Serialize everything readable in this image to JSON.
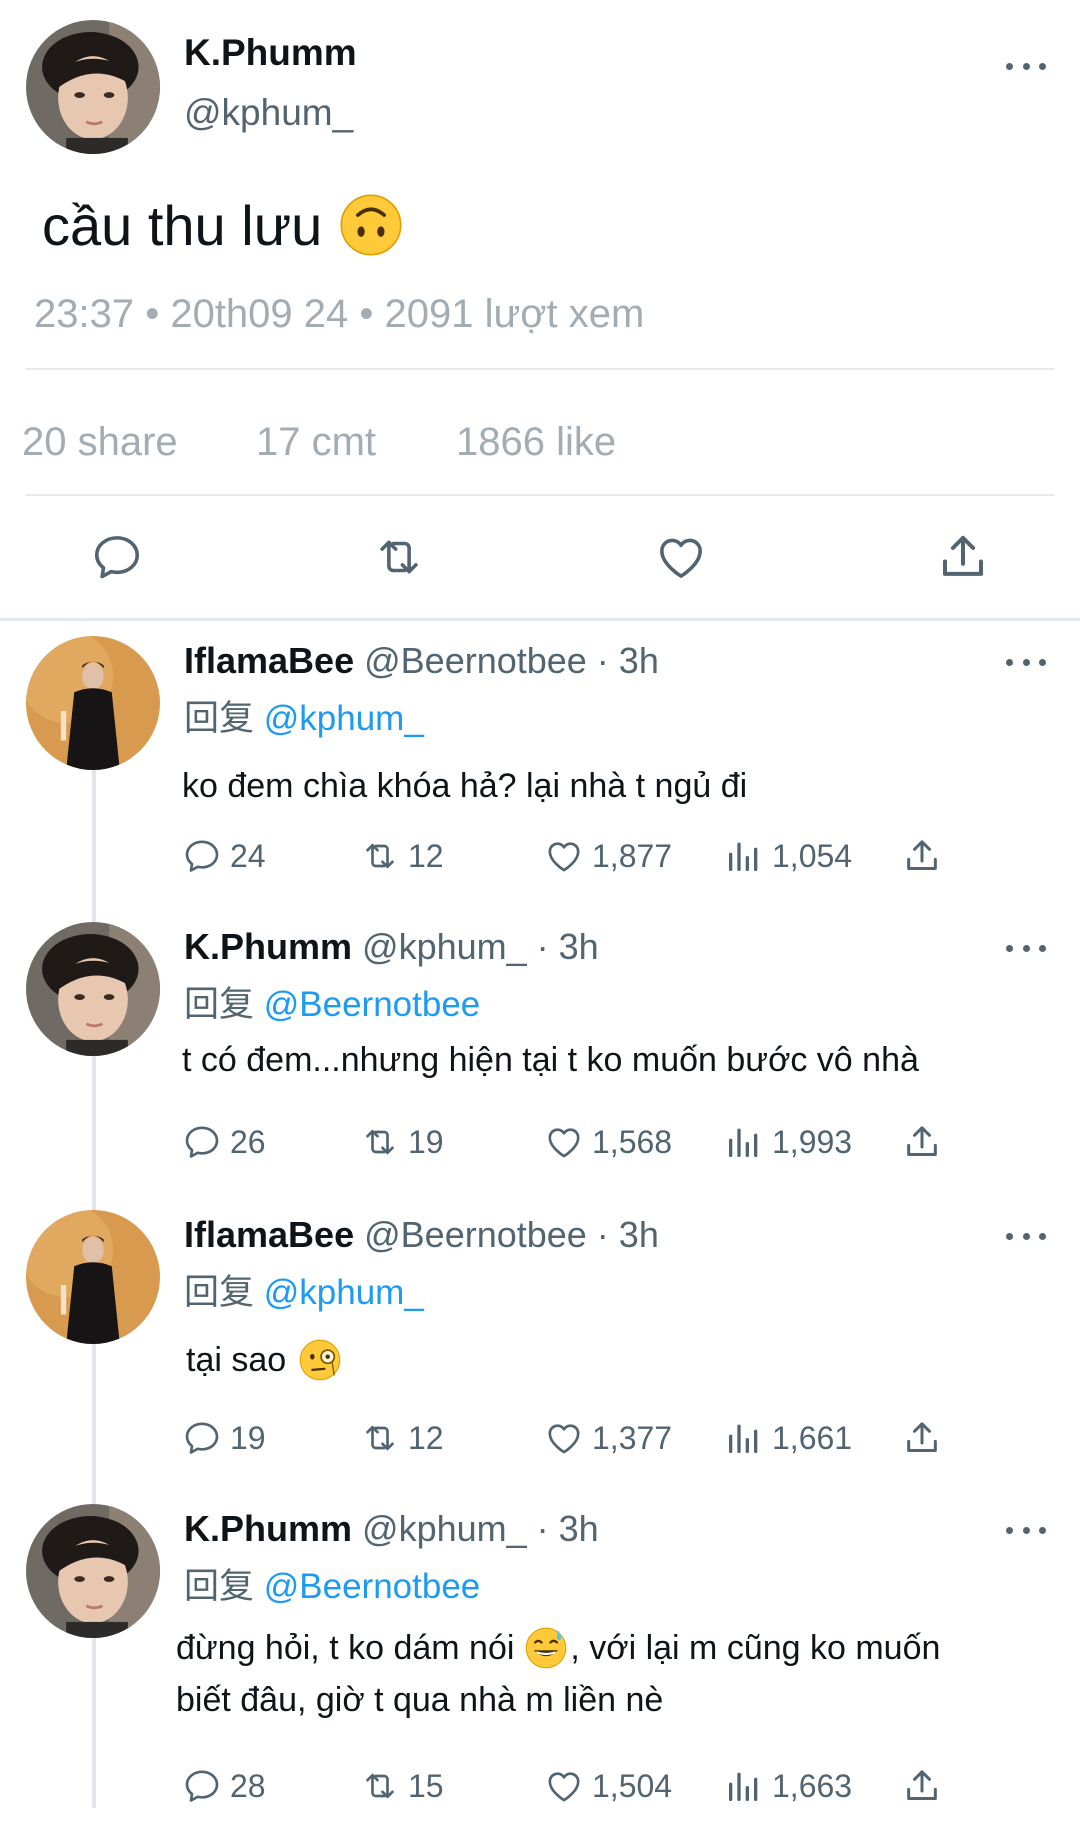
{
  "main_tweet": {
    "author_name": "K.Phumm",
    "author_handle": "@kphum_",
    "text": "cầu thu lưu",
    "emoji_icon": "upside-down-face-emoji",
    "meta": "23:37 • 20th09 24 • 2091 lượt xem",
    "stats": {
      "shares": "20 share",
      "comments": "17 cmt",
      "likes": "1866 like"
    },
    "actions": [
      "reply-icon",
      "retweet-icon",
      "like-icon",
      "share-icon"
    ]
  },
  "replies": [
    {
      "author_name": "IflamaBee",
      "author_handle": "@Beernotbee · 3h",
      "reply_prefix": "回复",
      "reply_to": "@kphum_",
      "text": "ko đem chìa khóa hả? lại nhà t ngủ đi",
      "counts": {
        "replies": "24",
        "retweets": "12",
        "likes": "1,877",
        "views": "1,054"
      }
    },
    {
      "author_name": "K.Phumm",
      "author_handle": "@kphum_ · 3h",
      "reply_prefix": "回复",
      "reply_to": "@Beernotbee",
      "text": "t có đem...nhưng hiện tại t ko muốn bước vô nhà",
      "counts": {
        "replies": "26",
        "retweets": "19",
        "likes": "1,568",
        "views": "1,993"
      }
    },
    {
      "author_name": "IflamaBee",
      "author_handle": "@Beernotbee · 3h",
      "reply_prefix": "回复",
      "reply_to": "@kphum_",
      "text": "tại sao",
      "emoji_icon": "face-with-monocle-emoji",
      "counts": {
        "replies": "19",
        "retweets": "12",
        "likes": "1,377",
        "views": "1,661"
      }
    },
    {
      "author_name": "K.Phumm",
      "author_handle": "@kphum_ · 3h",
      "reply_prefix": "回复",
      "reply_to": "@Beernotbee",
      "text_a": "đừng hỏi, t ko dám nói",
      "emoji_icon": "grinning-sweat-emoji",
      "text_b": ", với lại m cũng ko muốn",
      "text_c": "biết đâu, giờ t qua nhà m liền nè",
      "counts": {
        "replies": "28",
        "retweets": "15",
        "likes": "1,504",
        "views": "1,663"
      }
    }
  ],
  "colors": {
    "accent": "#1d9bf0",
    "muted": "#536471",
    "meta": "#a3abb3"
  }
}
